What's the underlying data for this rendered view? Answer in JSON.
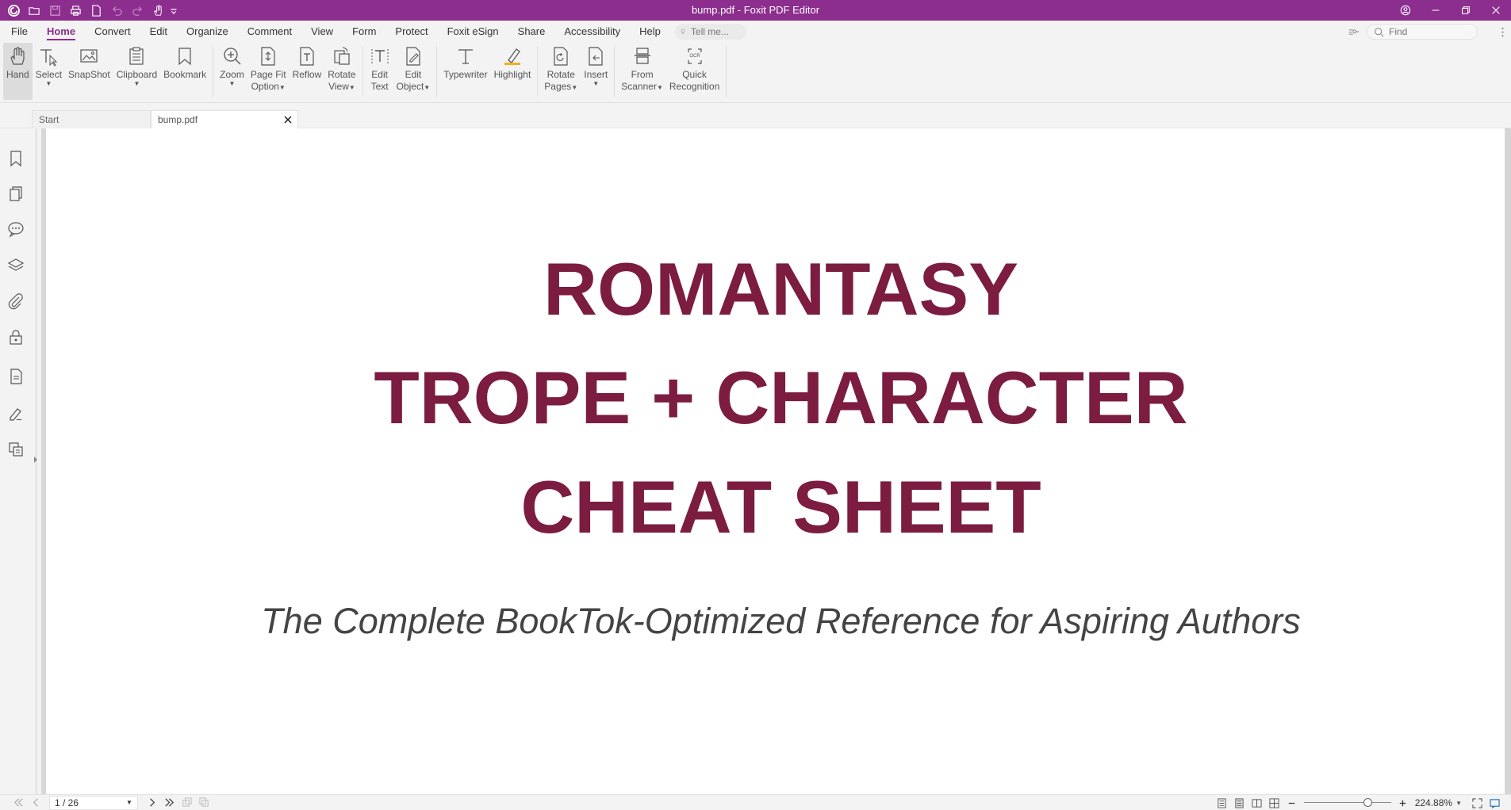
{
  "window": {
    "title": "bump.pdf - Foxit PDF Editor",
    "accent": "#8c2e8e"
  },
  "quick_access": [
    "foxit-logo-icon",
    "open-icon",
    "save-icon",
    "print-icon",
    "new-icon",
    "undo-icon",
    "redo-icon",
    "hand-tool-icon",
    "customize-icon"
  ],
  "menu": {
    "items": [
      "File",
      "Home",
      "Convert",
      "Edit",
      "Organize",
      "Comment",
      "View",
      "Form",
      "Protect",
      "Foxit eSign",
      "Share",
      "Accessibility",
      "Help"
    ],
    "active": "Home",
    "tellme_placeholder": "Tell me...",
    "find_placeholder": "Find"
  },
  "ribbon": {
    "hand": "Hand",
    "select": "Select",
    "snapshot": "SnapShot",
    "clipboard": "Clipboard",
    "bookmark": "Bookmark",
    "zoom": "Zoom",
    "page_fit_1": "Page Fit",
    "page_fit_2": "Option",
    "reflow": "Reflow",
    "rotate_view_1": "Rotate",
    "rotate_view_2": "View",
    "edit_text_1": "Edit",
    "edit_text_2": "Text",
    "edit_object_1": "Edit",
    "edit_object_2": "Object",
    "typewriter": "Typewriter",
    "highlight": "Highlight",
    "rotate_pages_1": "Rotate",
    "rotate_pages_2": "Pages",
    "insert": "Insert",
    "from_scanner_1": "From",
    "from_scanner_2": "Scanner",
    "quick_recog_1": "Quick",
    "quick_recog_2": "Recognition"
  },
  "tabs": {
    "start": "Start",
    "current": "bump.pdf"
  },
  "document": {
    "line1": "ROMANTASY",
    "line2": "TROPE + CHARACTER",
    "line3": "CHEAT SHEET",
    "subtitle": "The Complete BookTok-Optimized Reference for Aspiring Authors",
    "heading_color": "#7b1c40"
  },
  "status": {
    "page_value": "1 / 26",
    "zoom": "224.88%"
  }
}
